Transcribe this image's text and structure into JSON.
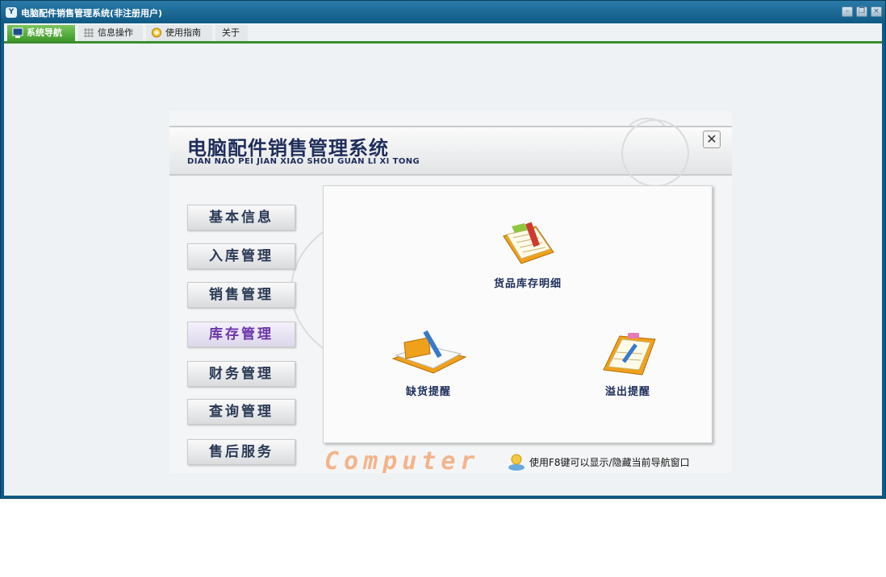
{
  "window": {
    "title": "电脑配件销售管理系统(非注册用户)",
    "app_icon_text": "Y"
  },
  "menubar": {
    "items": [
      {
        "label": "系统导航",
        "icon": "monitor-icon"
      },
      {
        "label": "信息操作",
        "icon": "grid-icon"
      },
      {
        "label": "使用指南",
        "icon": "help-icon"
      },
      {
        "label": "关于",
        "icon": ""
      }
    ]
  },
  "panel": {
    "title": "电脑配件销售管理系统",
    "subtitle": "DIAN NAO PEI JIAN XIAO SHOU GUAN LI XI TONG",
    "close": "✕"
  },
  "sidebar": {
    "items": [
      {
        "label": "基本信息"
      },
      {
        "label": "入库管理"
      },
      {
        "label": "销售管理"
      },
      {
        "label": "库存管理"
      },
      {
        "label": "财务管理"
      },
      {
        "label": "查询管理"
      },
      {
        "label": "售后服务"
      }
    ],
    "selected": "库存管理"
  },
  "content": {
    "features": [
      {
        "label": "货品库存明细",
        "icon": "documents-icon"
      },
      {
        "label": "缺货提醒",
        "icon": "notebook-pen-icon"
      },
      {
        "label": "溢出提醒",
        "icon": "clipboard-pen-icon"
      }
    ]
  },
  "footer": {
    "logo": "Computer",
    "hint": "使用F8键可以显示/隐藏当前导航窗口"
  },
  "colors": {
    "title_bar": "#0f5a85",
    "menu_active": "#3e9a2a",
    "panel_text": "#1e2d5a",
    "selected_item": "#6a35a8",
    "logo": "#f3b48a"
  }
}
